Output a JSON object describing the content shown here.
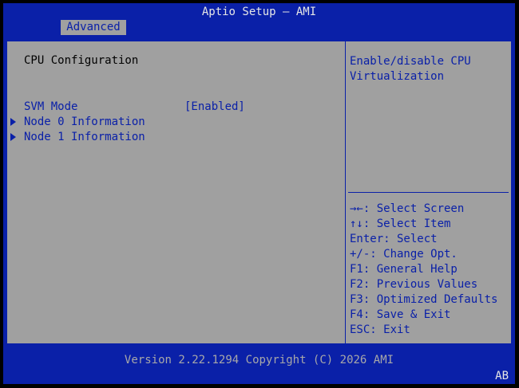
{
  "header": {
    "title": "Aptio Setup – AMI",
    "tab": "Advanced"
  },
  "main": {
    "section_title": "CPU Configuration",
    "items": [
      {
        "label": "SVM Mode",
        "value": "[Enabled]"
      },
      {
        "label": "Node 0 Information"
      },
      {
        "label": "Node 1 Information"
      }
    ]
  },
  "help": {
    "description": "Enable/disable CPU\nVirtualization",
    "keys": [
      "→←: Select Screen",
      "↑↓: Select Item",
      "Enter: Select",
      "+/-: Change Opt.",
      "F1: General Help",
      "F2: Previous Values",
      "F3: Optimized Defaults",
      "F4: Save & Exit",
      "ESC: Exit"
    ]
  },
  "footer": {
    "version": "Version 2.22.1294 Copyright (C) 2026 AMI",
    "corner": "AB"
  },
  "colors": {
    "blue": "#0a20a8",
    "gray": "#a0a0a0",
    "white": "#e6e6e6"
  }
}
